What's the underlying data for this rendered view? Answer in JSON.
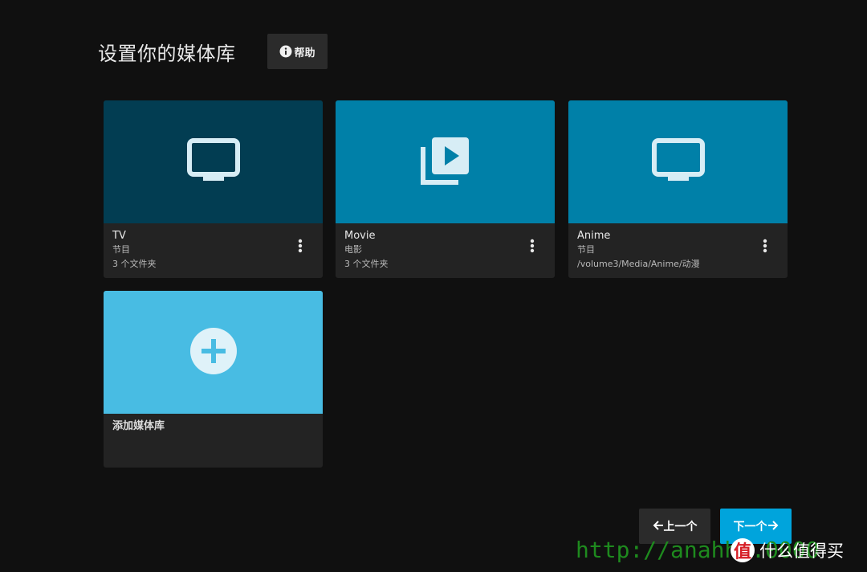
{
  "header": {
    "title": "设置你的媒体库",
    "help_label": "帮助"
  },
  "libraries": [
    {
      "name": "TV",
      "type": "节目",
      "detail": "3 个文件夹",
      "icon": "tv-icon",
      "color": "#023d52"
    },
    {
      "name": "Movie",
      "type": "电影",
      "detail": "3 个文件夹",
      "icon": "video-library-icon",
      "color": "#0080a8"
    },
    {
      "name": "Anime",
      "type": "节目",
      "detail": "/volume3/Media/Anime/动漫",
      "icon": "tv-icon",
      "color": "#0080a8"
    }
  ],
  "add_library": {
    "label": "添加媒体库",
    "icon": "plus-circle-icon",
    "color": "#48bce3"
  },
  "footer": {
    "prev_label": "上一个",
    "next_label": "下一个",
    "next_color": "#00a4dc"
  },
  "watermark": {
    "url": "http://anahhs.0000",
    "brand": "什么值得买",
    "brand_logo": "值"
  },
  "colors": {
    "background": "#101010",
    "card_footer": "#232323",
    "icon_light": "#d7edf5"
  }
}
